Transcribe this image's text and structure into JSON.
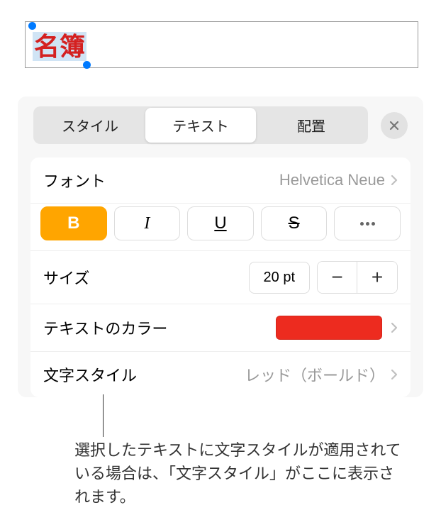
{
  "textbox": {
    "selected_text": "名簿"
  },
  "tabs": {
    "style": "スタイル",
    "text": "テキスト",
    "arrange": "配置"
  },
  "font": {
    "label": "フォント",
    "value": "Helvetica Neue"
  },
  "format_buttons": {
    "bold": "B",
    "italic": "I",
    "underline": "U",
    "strike": "S"
  },
  "size": {
    "label": "サイズ",
    "value": "20 pt",
    "minus": "−",
    "plus": "+"
  },
  "text_color": {
    "label": "テキストのカラー",
    "color": "#ed2b1f"
  },
  "char_style": {
    "label": "文字スタイル",
    "value": "レッド（ボールド）"
  },
  "annotation": "選択したテキストに文字スタイルが適用されている場合は、「文字スタイル」がここに表示されます。"
}
